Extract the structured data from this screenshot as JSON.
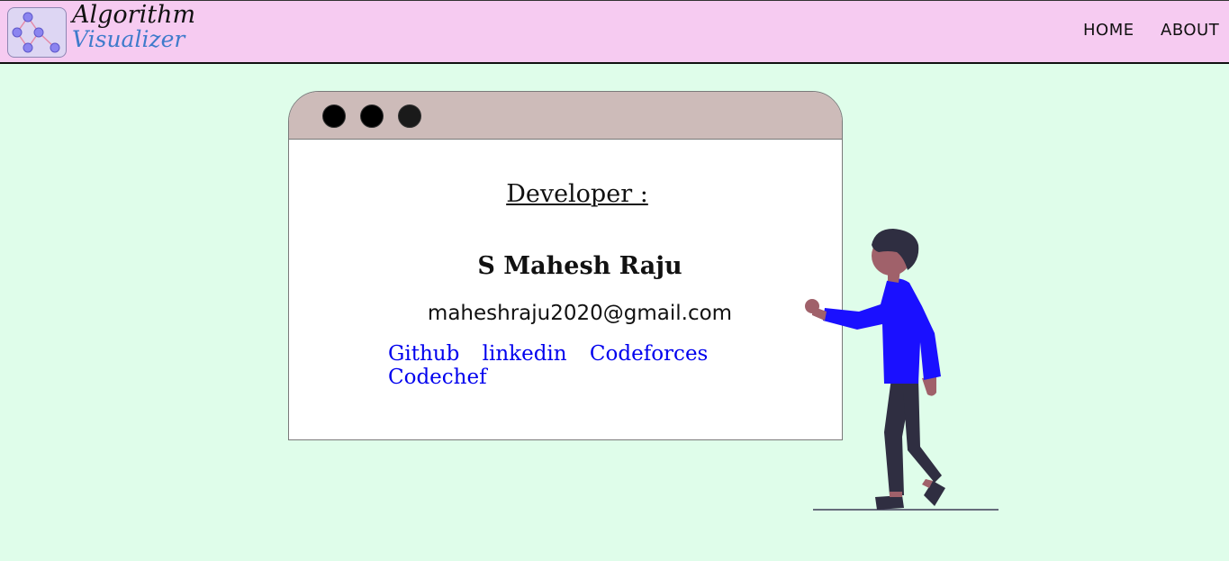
{
  "header": {
    "brand_line1": "Algorithm",
    "brand_line2": "Visualizer",
    "nav": [
      {
        "label": "HOME"
      },
      {
        "label": "ABOUT"
      }
    ]
  },
  "card": {
    "heading": "Developer :",
    "name": "S Mahesh Raju",
    "email": "maheshraju2020@gmail.com",
    "links": [
      {
        "label": "Github"
      },
      {
        "label": "linkedin"
      },
      {
        "label": "Codeforces"
      },
      {
        "label": "Codechef"
      }
    ]
  },
  "colors": {
    "page_bg": "#dffdea",
    "navbar_bg": "#f6cbf1",
    "window_bar": "#cdbbb9",
    "link": "#0000ee",
    "brand_blue": "#3f7bcb",
    "shirt": "#1a10ff"
  }
}
